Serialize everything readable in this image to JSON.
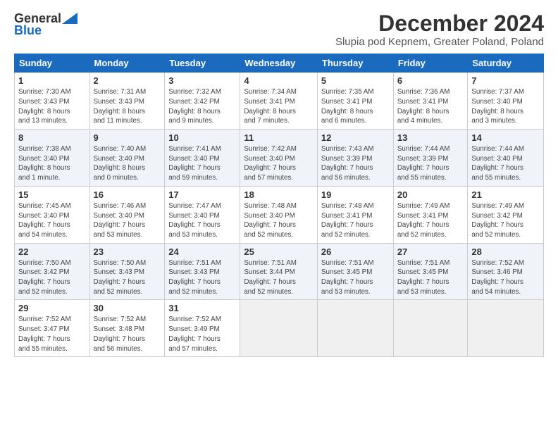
{
  "header": {
    "logo_general": "General",
    "logo_blue": "Blue",
    "month_title": "December 2024",
    "location": "Slupia pod Kepnem, Greater Poland, Poland"
  },
  "weekdays": [
    "Sunday",
    "Monday",
    "Tuesday",
    "Wednesday",
    "Thursday",
    "Friday",
    "Saturday"
  ],
  "weeks": [
    [
      {
        "day": "1",
        "info": "Sunrise: 7:30 AM\nSunset: 3:43 PM\nDaylight: 8 hours\nand 13 minutes."
      },
      {
        "day": "2",
        "info": "Sunrise: 7:31 AM\nSunset: 3:43 PM\nDaylight: 8 hours\nand 11 minutes."
      },
      {
        "day": "3",
        "info": "Sunrise: 7:32 AM\nSunset: 3:42 PM\nDaylight: 8 hours\nand 9 minutes."
      },
      {
        "day": "4",
        "info": "Sunrise: 7:34 AM\nSunset: 3:41 PM\nDaylight: 8 hours\nand 7 minutes."
      },
      {
        "day": "5",
        "info": "Sunrise: 7:35 AM\nSunset: 3:41 PM\nDaylight: 8 hours\nand 6 minutes."
      },
      {
        "day": "6",
        "info": "Sunrise: 7:36 AM\nSunset: 3:41 PM\nDaylight: 8 hours\nand 4 minutes."
      },
      {
        "day": "7",
        "info": "Sunrise: 7:37 AM\nSunset: 3:40 PM\nDaylight: 8 hours\nand 3 minutes."
      }
    ],
    [
      {
        "day": "8",
        "info": "Sunrise: 7:38 AM\nSunset: 3:40 PM\nDaylight: 8 hours\nand 1 minute."
      },
      {
        "day": "9",
        "info": "Sunrise: 7:40 AM\nSunset: 3:40 PM\nDaylight: 8 hours\nand 0 minutes."
      },
      {
        "day": "10",
        "info": "Sunrise: 7:41 AM\nSunset: 3:40 PM\nDaylight: 7 hours\nand 59 minutes."
      },
      {
        "day": "11",
        "info": "Sunrise: 7:42 AM\nSunset: 3:40 PM\nDaylight: 7 hours\nand 57 minutes."
      },
      {
        "day": "12",
        "info": "Sunrise: 7:43 AM\nSunset: 3:39 PM\nDaylight: 7 hours\nand 56 minutes."
      },
      {
        "day": "13",
        "info": "Sunrise: 7:44 AM\nSunset: 3:39 PM\nDaylight: 7 hours\nand 55 minutes."
      },
      {
        "day": "14",
        "info": "Sunrise: 7:44 AM\nSunset: 3:40 PM\nDaylight: 7 hours\nand 55 minutes."
      }
    ],
    [
      {
        "day": "15",
        "info": "Sunrise: 7:45 AM\nSunset: 3:40 PM\nDaylight: 7 hours\nand 54 minutes."
      },
      {
        "day": "16",
        "info": "Sunrise: 7:46 AM\nSunset: 3:40 PM\nDaylight: 7 hours\nand 53 minutes."
      },
      {
        "day": "17",
        "info": "Sunrise: 7:47 AM\nSunset: 3:40 PM\nDaylight: 7 hours\nand 53 minutes."
      },
      {
        "day": "18",
        "info": "Sunrise: 7:48 AM\nSunset: 3:40 PM\nDaylight: 7 hours\nand 52 minutes."
      },
      {
        "day": "19",
        "info": "Sunrise: 7:48 AM\nSunset: 3:41 PM\nDaylight: 7 hours\nand 52 minutes."
      },
      {
        "day": "20",
        "info": "Sunrise: 7:49 AM\nSunset: 3:41 PM\nDaylight: 7 hours\nand 52 minutes."
      },
      {
        "day": "21",
        "info": "Sunrise: 7:49 AM\nSunset: 3:42 PM\nDaylight: 7 hours\nand 52 minutes."
      }
    ],
    [
      {
        "day": "22",
        "info": "Sunrise: 7:50 AM\nSunset: 3:42 PM\nDaylight: 7 hours\nand 52 minutes."
      },
      {
        "day": "23",
        "info": "Sunrise: 7:50 AM\nSunset: 3:43 PM\nDaylight: 7 hours\nand 52 minutes."
      },
      {
        "day": "24",
        "info": "Sunrise: 7:51 AM\nSunset: 3:43 PM\nDaylight: 7 hours\nand 52 minutes."
      },
      {
        "day": "25",
        "info": "Sunrise: 7:51 AM\nSunset: 3:44 PM\nDaylight: 7 hours\nand 52 minutes."
      },
      {
        "day": "26",
        "info": "Sunrise: 7:51 AM\nSunset: 3:45 PM\nDaylight: 7 hours\nand 53 minutes."
      },
      {
        "day": "27",
        "info": "Sunrise: 7:51 AM\nSunset: 3:45 PM\nDaylight: 7 hours\nand 53 minutes."
      },
      {
        "day": "28",
        "info": "Sunrise: 7:52 AM\nSunset: 3:46 PM\nDaylight: 7 hours\nand 54 minutes."
      }
    ],
    [
      {
        "day": "29",
        "info": "Sunrise: 7:52 AM\nSunset: 3:47 PM\nDaylight: 7 hours\nand 55 minutes."
      },
      {
        "day": "30",
        "info": "Sunrise: 7:52 AM\nSunset: 3:48 PM\nDaylight: 7 hours\nand 56 minutes."
      },
      {
        "day": "31",
        "info": "Sunrise: 7:52 AM\nSunset: 3:49 PM\nDaylight: 7 hours\nand 57 minutes."
      },
      {
        "day": "",
        "info": ""
      },
      {
        "day": "",
        "info": ""
      },
      {
        "day": "",
        "info": ""
      },
      {
        "day": "",
        "info": ""
      }
    ]
  ]
}
